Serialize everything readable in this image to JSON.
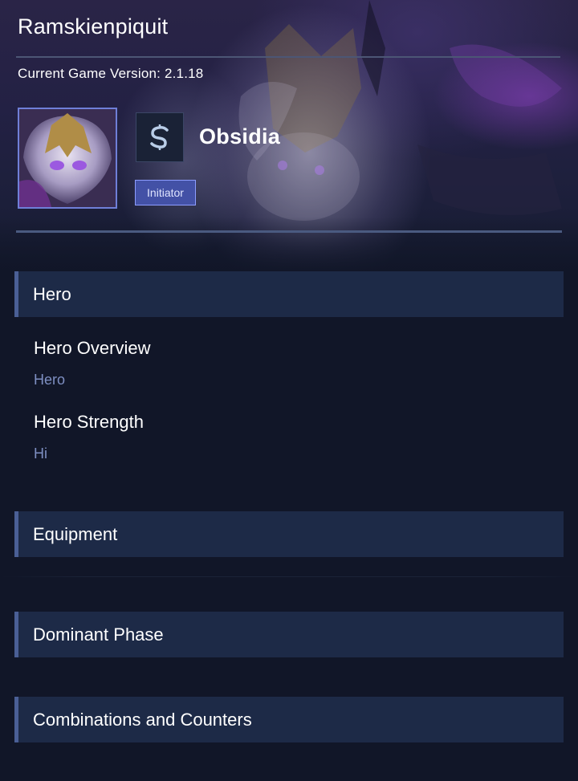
{
  "header": {
    "app_title": "Ramskienpiquit",
    "game_version": "Current Game Version: 2.1.18"
  },
  "hero": {
    "name": "Obsidia",
    "role_icon": "assassin-s-icon",
    "role_badge": "Initiator"
  },
  "sections": [
    {
      "label": "Hero",
      "items": [
        {
          "title": "Hero Overview",
          "value": "Hero"
        },
        {
          "title": "Hero Strength",
          "value": "Hi"
        }
      ]
    },
    {
      "label": "Equipment"
    },
    {
      "label": "Dominant Phase"
    },
    {
      "label": "Combinations and Counters"
    }
  ],
  "colors": {
    "background": "#111628",
    "section_header_bg": "#1d2a47",
    "section_accent": "#4a5f96",
    "badge_bg": "#4351a6",
    "badge_border": "#8d9dff",
    "muted_value": "#7e8fc2"
  }
}
